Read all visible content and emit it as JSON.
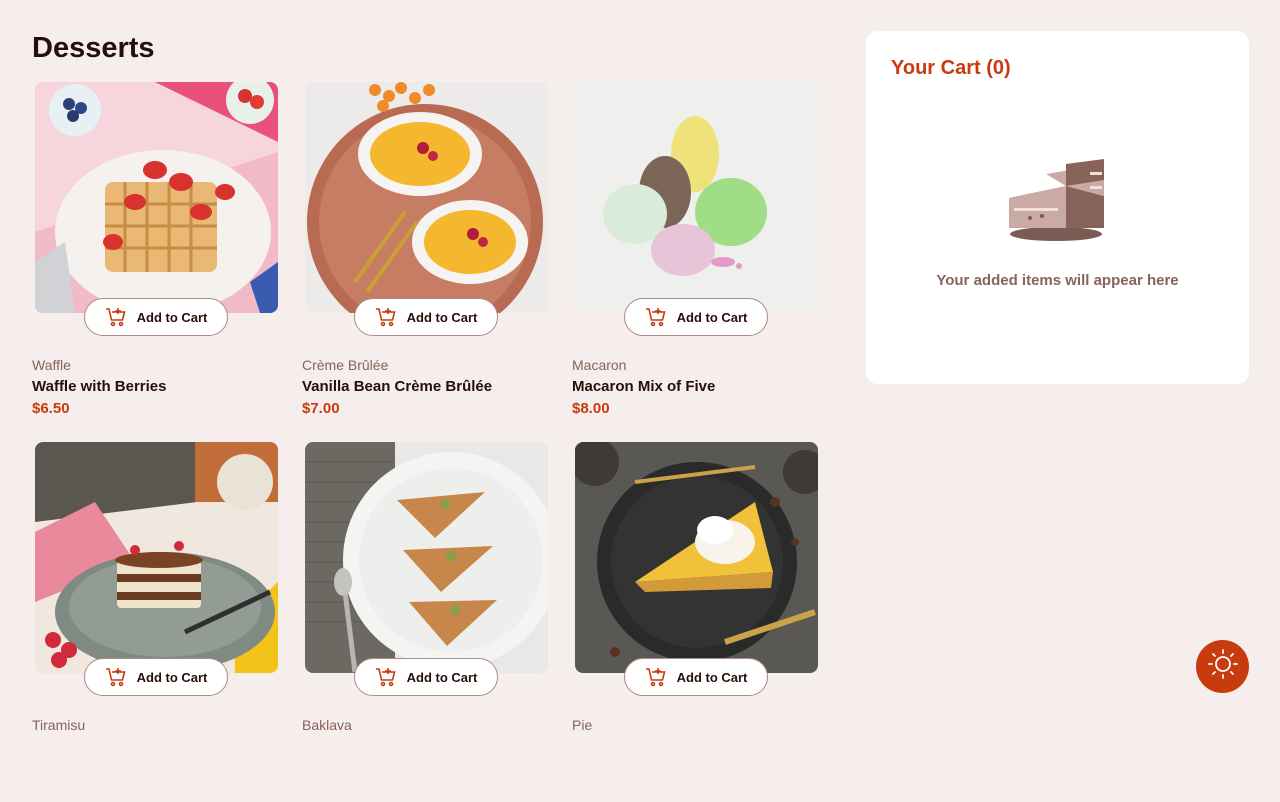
{
  "page": {
    "title": "Desserts"
  },
  "products": [
    {
      "category": "Waffle",
      "name": "Waffle with Berries",
      "price": "$6.50",
      "button": "Add to Cart",
      "image_icon": "waffle-image"
    },
    {
      "category": "Crème Brûlée",
      "name": "Vanilla Bean Crème Brûlée",
      "price": "$7.00",
      "button": "Add to Cart",
      "image_icon": "creme-brulee-image"
    },
    {
      "category": "Macaron",
      "name": "Macaron Mix of Five",
      "price": "$8.00",
      "button": "Add to Cart",
      "image_icon": "macaron-image"
    },
    {
      "category": "Tiramisu",
      "name": "",
      "price": "",
      "button": "Add to Cart",
      "image_icon": "tiramisu-image"
    },
    {
      "category": "Baklava",
      "name": "",
      "price": "",
      "button": "Add to Cart",
      "image_icon": "baklava-image"
    },
    {
      "category": "Pie",
      "name": "",
      "price": "",
      "button": "Add to Cart",
      "image_icon": "pie-image"
    }
  ],
  "cart": {
    "title": "Your Cart (0)",
    "empty_message": "Your added items will appear here",
    "illustration_icon": "empty-cake-icon"
  },
  "theme_toggle": {
    "icon": "sun-icon"
  },
  "colors": {
    "background": "#f5eeec",
    "accent": "#c73b0f",
    "text_dark": "#260f08",
    "text_muted": "#87635a",
    "cart_bg": "#ffffff"
  }
}
